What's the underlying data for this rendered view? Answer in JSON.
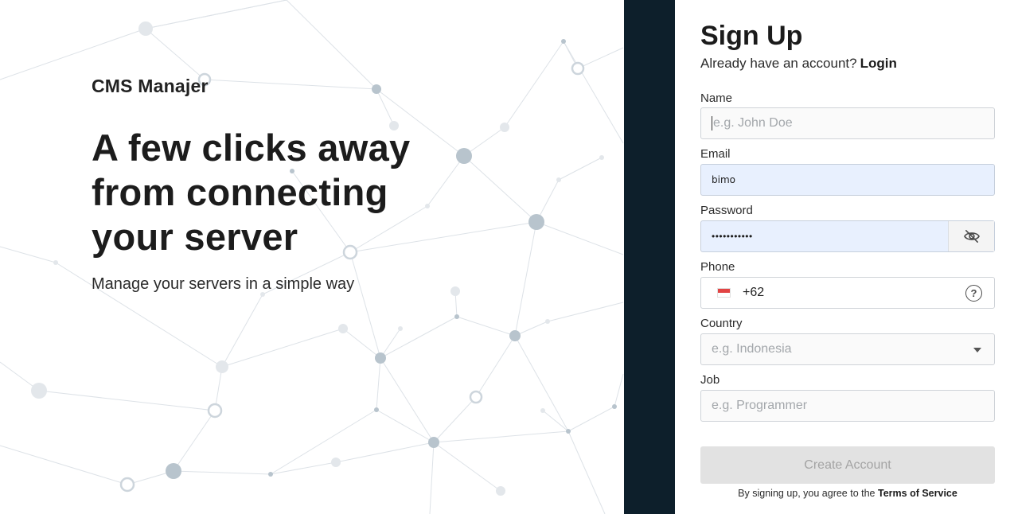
{
  "hero": {
    "brand": "CMS Manajer",
    "headline": [
      "A few clicks away",
      "from connecting",
      "your server"
    ],
    "tagline": "Manage your servers in a simple way"
  },
  "form": {
    "title": "Sign Up",
    "login_prompt": "Already have an account?",
    "login_link": "Login",
    "fields": {
      "name": {
        "label": "Name",
        "placeholder": "e.g. John Doe",
        "value": ""
      },
      "email": {
        "label": "Email",
        "value": "bimo"
      },
      "password": {
        "label": "Password",
        "value": "•••••••••••"
      },
      "phone": {
        "label": "Phone",
        "country_code": "+62"
      },
      "country": {
        "label": "Country",
        "placeholder": "e.g. Indonesia"
      },
      "job": {
        "label": "Job",
        "placeholder": "e.g. Programmer"
      }
    },
    "submit_label": "Create Account",
    "terms_prefix": "By signing up, you agree to the",
    "terms_link": "Terms of Service"
  },
  "colors": {
    "strip": "#0d1f2b",
    "autofill": "#e8f0fe",
    "button_disabled": "#e2e2e2",
    "network_line": "#d6dce2",
    "network_node": "#aebcc7"
  },
  "icons": [
    "eye-off-icon",
    "indonesia-flag-icon",
    "help-circle-icon",
    "chevron-down-icon"
  ]
}
